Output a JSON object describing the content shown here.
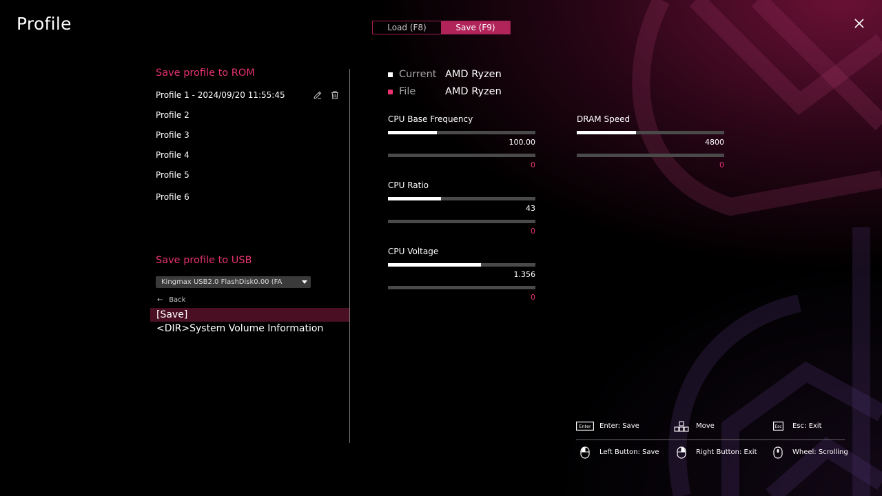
{
  "page": {
    "title": "Profile"
  },
  "tabs": [
    {
      "label": "Load (F8)",
      "active": false
    },
    {
      "label": "Save (F9)",
      "active": true
    }
  ],
  "rom": {
    "title": "Save profile to ROM",
    "profiles": [
      "Profile 1 - 2024/09/20 11:55:45",
      "Profile 2",
      "Profile 3",
      "Profile 4",
      "Profile 5",
      "Profile 6"
    ]
  },
  "usb": {
    "title": "Save profile to USB",
    "device": "Kingmax USB2.0 FlashDisk0.00 (FA",
    "back_label": "Back",
    "files": [
      "[Save]",
      "<DIR>System Volume Information"
    ]
  },
  "legend": {
    "current_label": "Current",
    "current_value": "AMD Ryzen",
    "file_label": "File",
    "file_value": "AMD Ryzen"
  },
  "params": [
    {
      "label": "CPU Base Frequency",
      "current": "100.00",
      "current_fraction": 0.33,
      "file": "0"
    },
    {
      "label": "CPU Ratio",
      "current": "43",
      "current_fraction": 0.36,
      "file": "0"
    },
    {
      "label": "CPU Voltage",
      "current": "1.356",
      "current_fraction": 0.63,
      "file": "0"
    },
    {
      "label": "DRAM Speed",
      "current": "4800",
      "current_fraction": 0.4,
      "file": "0"
    }
  ],
  "help": {
    "enter": "Enter: Save",
    "move": "Move",
    "esc": "Esc: Exit",
    "left_button": "Left Button: Save",
    "right_button": "Right Button: Exit",
    "wheel": "Wheel: Scrolling",
    "enter_key": "Enter",
    "esc_key": "Esc"
  },
  "colors": {
    "accent": "#e8336e",
    "tab_active": "#b0245a",
    "selected_row": "#4a0f22",
    "bar_track": "#4a4a4a"
  }
}
